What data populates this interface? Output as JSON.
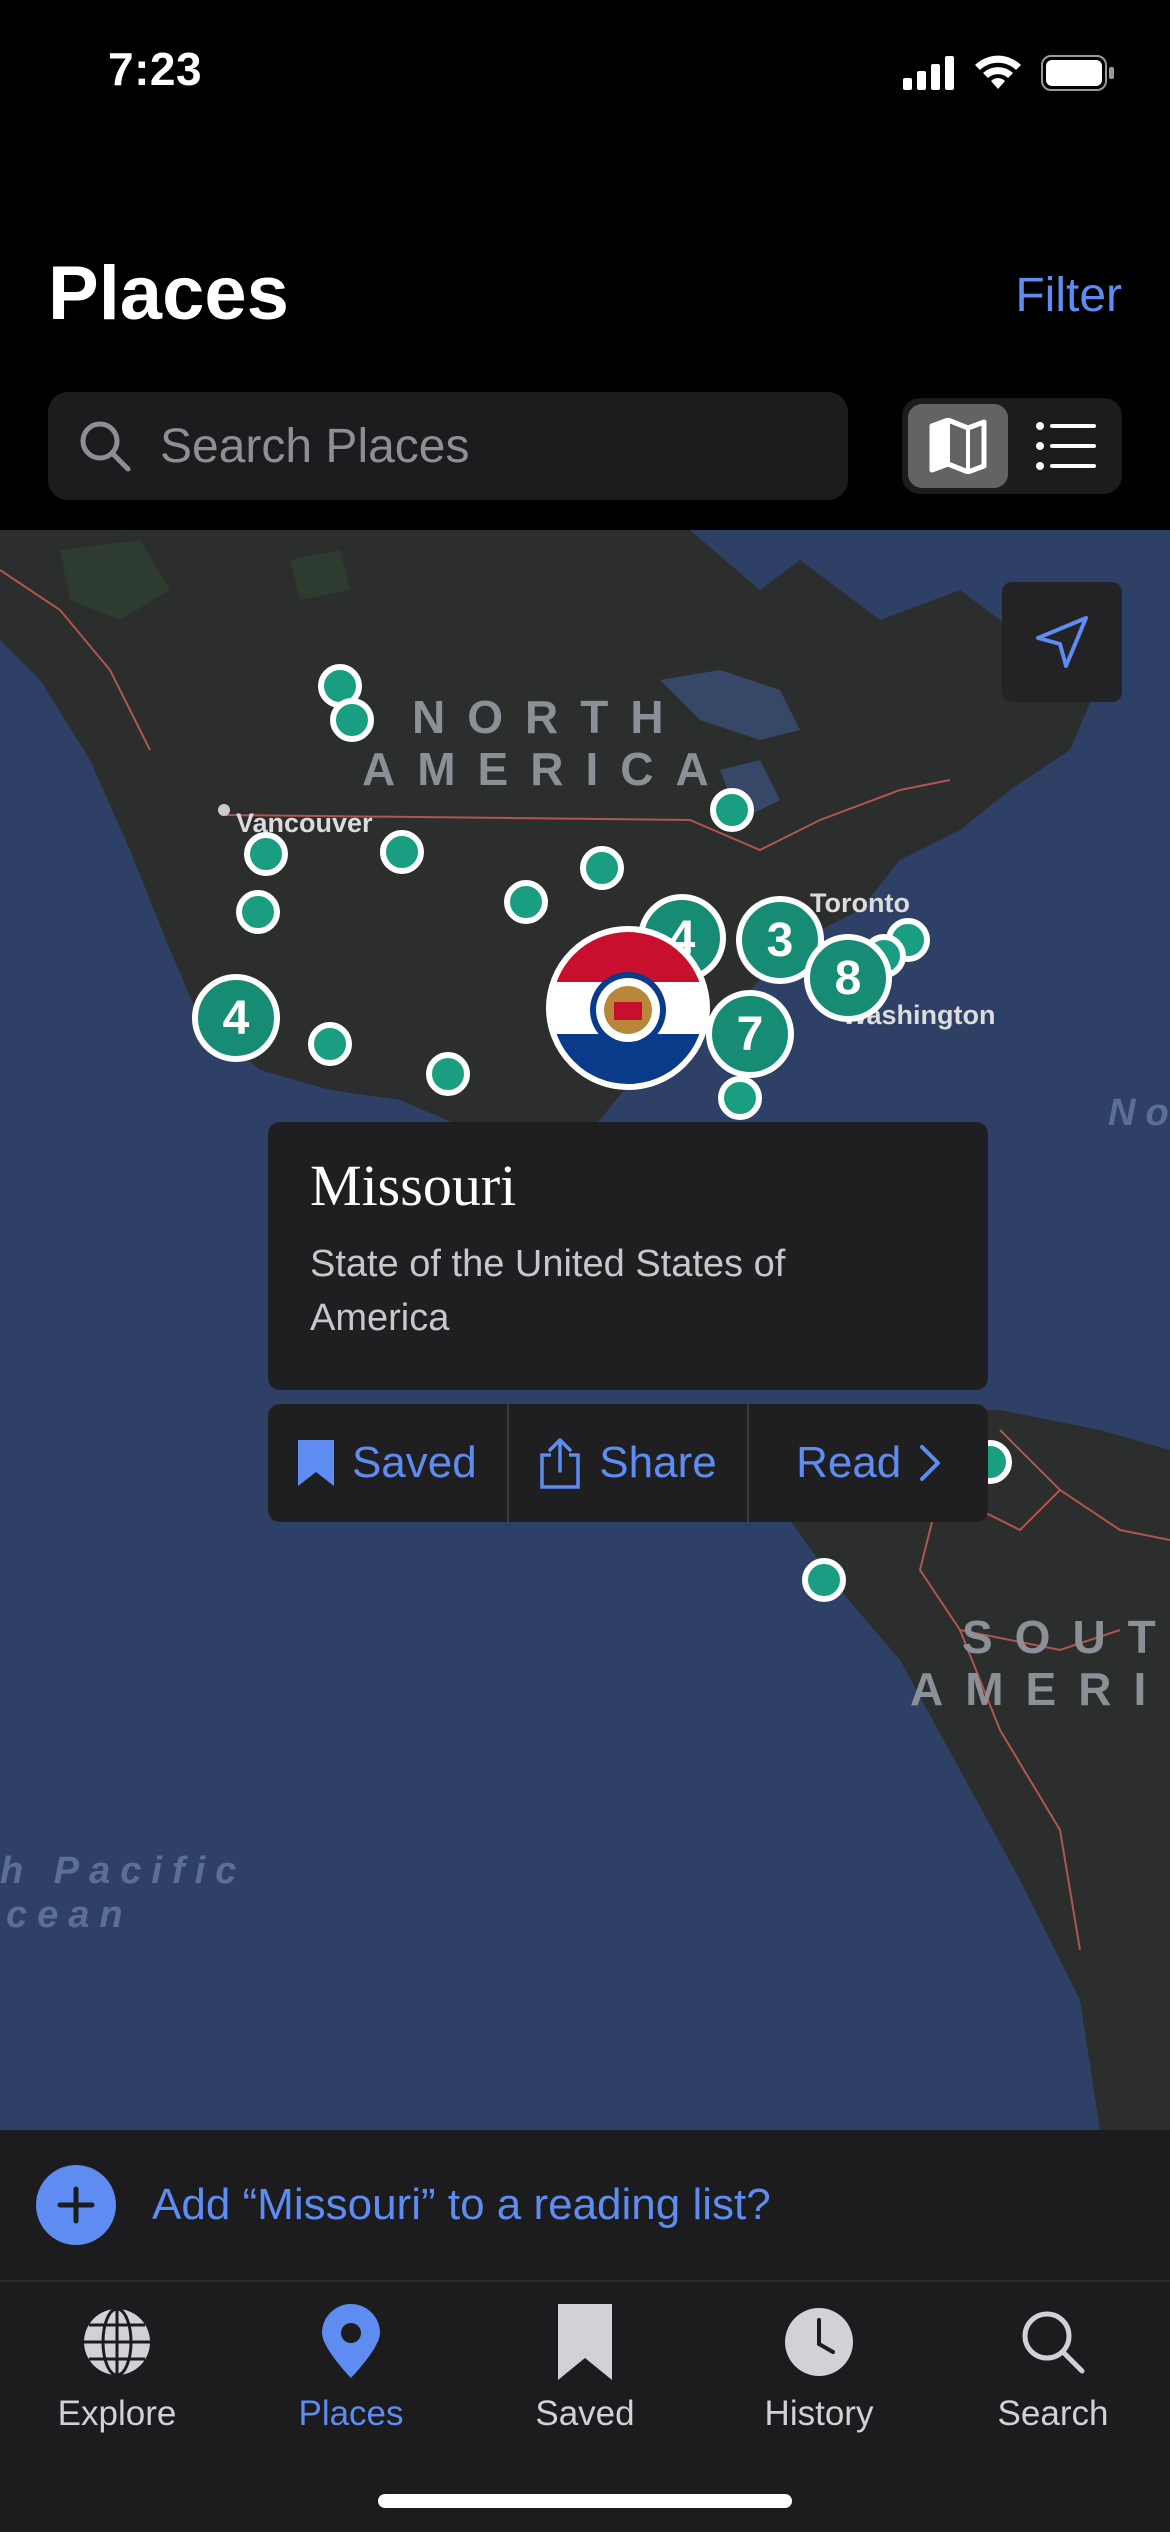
{
  "status_bar": {
    "time": "7:23"
  },
  "header": {
    "title": "Places",
    "filter_label": "Filter",
    "search_placeholder": "Search Places",
    "view_modes": [
      "map-icon",
      "list-icon"
    ],
    "active_view": "map"
  },
  "map": {
    "region_labels": [
      "NORTH",
      "AMERICA",
      "SOUT",
      "AMERI"
    ],
    "ocean_labels": [
      "h Pacific",
      "cean",
      "No"
    ],
    "cities": [
      "Vancouver",
      "Toronto",
      "Washington"
    ],
    "clusters": [
      "4",
      "4",
      "3",
      "8",
      "7"
    ],
    "selected_marker": "Missouri flag"
  },
  "popover": {
    "title": "Missouri",
    "description": "State of the United States of America",
    "actions": {
      "saved": "Saved",
      "share": "Share",
      "read": "Read"
    }
  },
  "banner": {
    "text": "Add “Missouri” to a reading list?"
  },
  "tabs": [
    {
      "label": "Explore",
      "icon": "globe-icon"
    },
    {
      "label": "Places",
      "icon": "map-pin-icon",
      "active": true
    },
    {
      "label": "Saved",
      "icon": "bookmark-icon"
    },
    {
      "label": "History",
      "icon": "clock-icon"
    },
    {
      "label": "Search",
      "icon": "search-icon"
    }
  ],
  "colors": {
    "accent": "#5e8cf0",
    "pin": "#1a9e82",
    "background": "#000000",
    "ocean": "#2f4066"
  }
}
